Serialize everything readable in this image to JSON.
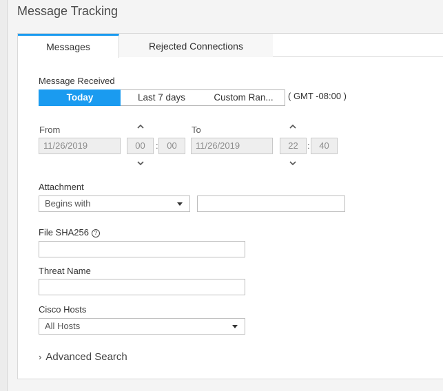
{
  "page": {
    "title": "Message Tracking"
  },
  "tabs": [
    {
      "label": "Messages",
      "active": true
    },
    {
      "label": "Rejected Connections",
      "active": false
    }
  ],
  "message_received": {
    "label": "Message Received",
    "ranges": [
      "Today",
      "Last 7 days",
      "Custom Ran..."
    ],
    "selected": "Today",
    "timezone": "( GMT -08:00 )"
  },
  "from": {
    "label": "From",
    "date": "11/26/2019",
    "hour": "00",
    "minute": "00"
  },
  "to": {
    "label": "To",
    "date": "11/26/2019",
    "hour": "22",
    "minute": "40"
  },
  "time_separator": ":",
  "attachment": {
    "label": "Attachment",
    "operator": "Begins with",
    "value": ""
  },
  "file_sha256": {
    "label": "File SHA256",
    "help_glyph": "?",
    "value": ""
  },
  "threat_name": {
    "label": "Threat Name",
    "value": ""
  },
  "cisco_hosts": {
    "label": "Cisco Hosts",
    "selected": "All Hosts"
  },
  "advanced": {
    "label": "Advanced Search",
    "arrow": "›"
  },
  "colors": {
    "accent": "#1a9bf0"
  }
}
